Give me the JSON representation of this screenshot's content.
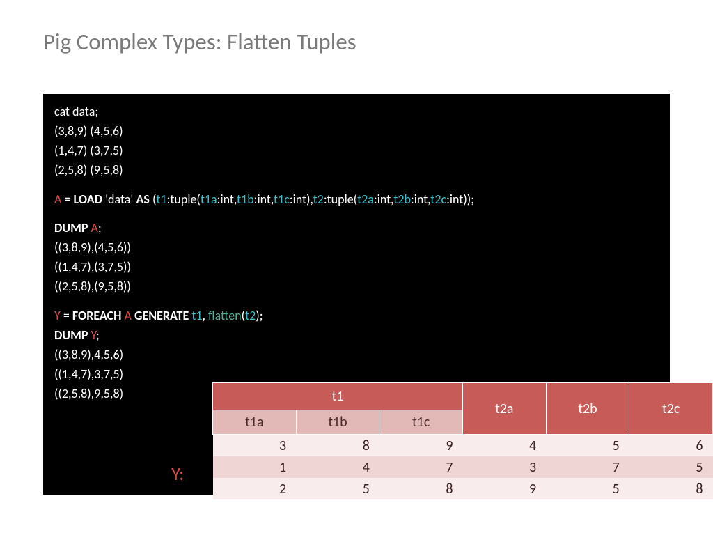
{
  "title": "Pig Complex Types: Flatten Tuples",
  "code": {
    "cat_cmd": "cat data;",
    "cat_out": [
      "(3,8,9) (4,5,6)",
      "(1,4,7) (3,7,5)",
      "(2,5,8) (9,5,8)"
    ],
    "load": {
      "a": "A",
      "eq": " = ",
      "load_kw": "LOAD",
      "data": " 'data' ",
      "as_kw": "AS",
      "open": " (",
      "t1": "t1",
      "mid1": ":tuple(",
      "t1a": "t1a",
      "i1": ":int,",
      "t1b": "t1b",
      "i2": ":int,",
      "t1c": "t1c",
      "i3": ":int),",
      "t2": "t2",
      "mid2": ":tuple(",
      "t2a": "t2a",
      "i4": ":int,",
      "t2b": "t2b",
      "i5": ":int,",
      "t2c": "t2c",
      "i6": ":int));"
    },
    "dump_a": {
      "kw": "DUMP ",
      "var": "A",
      "semi": ";"
    },
    "dump_a_out": [
      "((3,8,9),(4,5,6))",
      "((1,4,7),(3,7,5))",
      "((2,5,8),(9,5,8))"
    ],
    "y_gen": {
      "y": "Y",
      "eq": " = ",
      "fe": "FOREACH ",
      "a": "A ",
      "gen": "GENERATE ",
      "t1": "t1",
      "comma": ", ",
      "flatten": "flatten",
      "open": "(",
      "t2": "t2",
      "close": ");"
    },
    "dump_y": {
      "kw": "DUMP ",
      "var": "Y",
      "semi": ";"
    },
    "dump_y_out": [
      "((3,8,9),4,5,6)",
      "((1,4,7),3,7,5)",
      "((2,5,8),9,5,8)"
    ]
  },
  "y_label": "Y:",
  "chart_data": {
    "type": "table",
    "title": "Y:",
    "columns_top": [
      "t1",
      "t2a",
      "t2b",
      "t2c"
    ],
    "columns_sub": [
      "t1a",
      "t1b",
      "t1c"
    ],
    "rows": [
      {
        "t1a": 3,
        "t1b": 8,
        "t1c": 9,
        "t2a": 4,
        "t2b": 5,
        "t2c": 6
      },
      {
        "t1a": 1,
        "t1b": 4,
        "t1c": 7,
        "t2a": 3,
        "t2b": 7,
        "t2c": 5
      },
      {
        "t1a": 2,
        "t1b": 5,
        "t1c": 8,
        "t2a": 9,
        "t2b": 5,
        "t2c": 8
      }
    ]
  }
}
